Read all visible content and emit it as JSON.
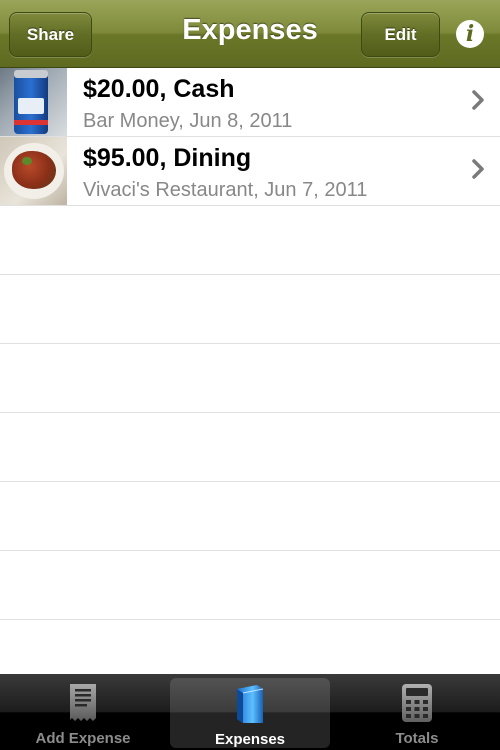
{
  "navbar": {
    "title": "Expenses",
    "share_label": "Share",
    "edit_label": "Edit",
    "info_glyph": "i"
  },
  "expenses": [
    {
      "title": "$20.00, Cash",
      "subtitle": "Bar Money, Jun 8, 2011",
      "thumbnail": "beer-can-photo"
    },
    {
      "title": "$95.00, Dining",
      "subtitle": "Vivaci's Restaurant, Jun 7, 2011",
      "thumbnail": "food-plate-photo"
    }
  ],
  "tabbar": {
    "tabs": [
      {
        "label": "Add Expense",
        "icon": "receipt-icon",
        "selected": false
      },
      {
        "label": "Expenses",
        "icon": "book-icon",
        "selected": true
      },
      {
        "label": "Totals",
        "icon": "calculator-icon",
        "selected": false
      }
    ]
  },
  "colors": {
    "navbar": "#7f8b3a",
    "tab_selected": "#ffffff",
    "tab_unselected": "#8c8c8c",
    "subtitle": "#888888"
  }
}
